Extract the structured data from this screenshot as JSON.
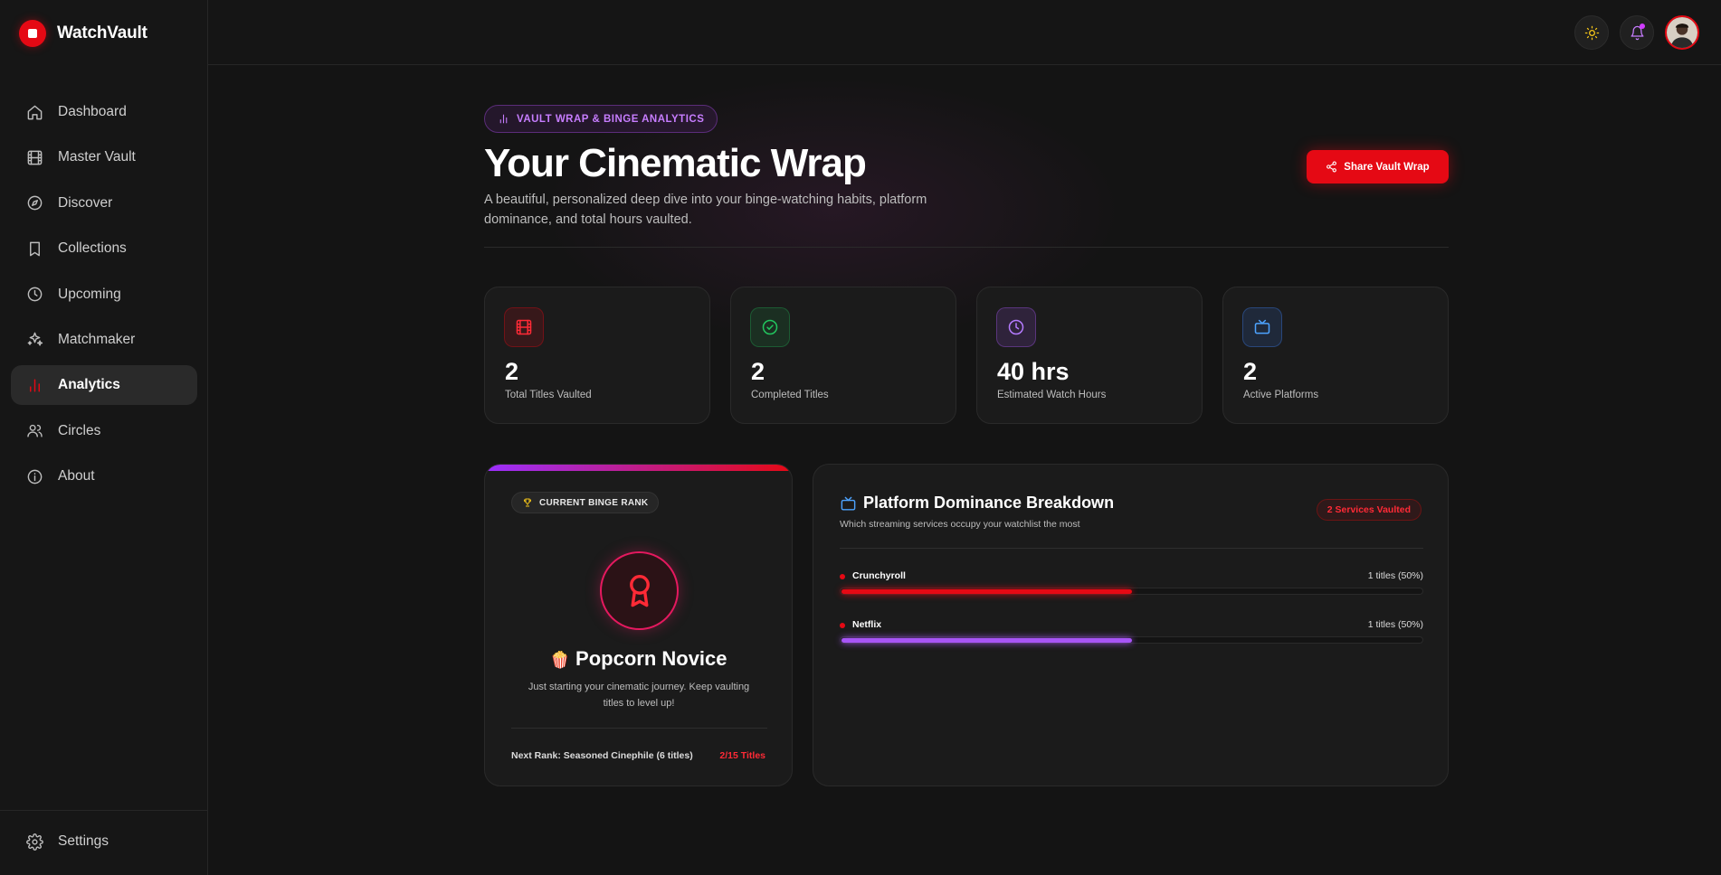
{
  "app": {
    "name": "WatchVault"
  },
  "sidebar": {
    "items": [
      {
        "label": "Dashboard",
        "icon": "home-icon"
      },
      {
        "label": "Master Vault",
        "icon": "film-icon"
      },
      {
        "label": "Discover",
        "icon": "compass-icon"
      },
      {
        "label": "Collections",
        "icon": "bookmark-icon"
      },
      {
        "label": "Upcoming",
        "icon": "clock-icon"
      },
      {
        "label": "Matchmaker",
        "icon": "sparkles-icon"
      },
      {
        "label": "Analytics",
        "icon": "bar-chart-icon",
        "active": true
      },
      {
        "label": "Circles",
        "icon": "users-icon"
      },
      {
        "label": "About",
        "icon": "info-icon"
      }
    ],
    "footer": {
      "label": "Settings",
      "icon": "gear-icon"
    }
  },
  "topbar": {
    "theme_icon": "sun-icon",
    "notification_icon": "bell-icon",
    "avatar_icon": "user-avatar"
  },
  "header": {
    "pill": "VAULT WRAP & BINGE ANALYTICS",
    "title": "Your Cinematic Wrap",
    "subtitle": "A beautiful, personalized deep dive into your binge-watching habits, platform dominance, and total hours vaulted.",
    "share_label": "Share Vault Wrap"
  },
  "stats": [
    {
      "value": "2",
      "label": "Total Titles Vaulted",
      "icon": "film-icon",
      "color": "#e50914"
    },
    {
      "value": "2",
      "label": "Completed Titles",
      "icon": "check-circle-icon",
      "color": "#22c55e"
    },
    {
      "value": "40 hrs",
      "label": "Estimated Watch Hours",
      "icon": "clock-icon",
      "color": "#a855f7"
    },
    {
      "value": "2",
      "label": "Active Platforms",
      "icon": "tv-icon",
      "color": "#3b82f6"
    }
  ],
  "rank": {
    "pill": "CURRENT BINGE RANK",
    "emoji": "🍿",
    "title": "Popcorn Novice",
    "description": "Just starting your cinematic journey. Keep vaulting titles to level up!",
    "next": "Next Rank: Seasoned Cinephile (6 titles)",
    "progress": "2/15 Titles"
  },
  "platforms": {
    "title": "Platform Dominance Breakdown",
    "subtitle": "Which streaming services occupy your watchlist the most",
    "badge": "2 Services Vaulted",
    "rows": [
      {
        "name": "Crunchyroll",
        "count": "1 titles (50%)",
        "fraction": 0.5,
        "color": "#e50914"
      },
      {
        "name": "Netflix",
        "count": "1 titles (50%)",
        "fraction": 0.5,
        "color": "#a855f7"
      }
    ]
  },
  "colors": {
    "accent": "#e50914",
    "purple": "#a855f7",
    "background": "#141414"
  }
}
